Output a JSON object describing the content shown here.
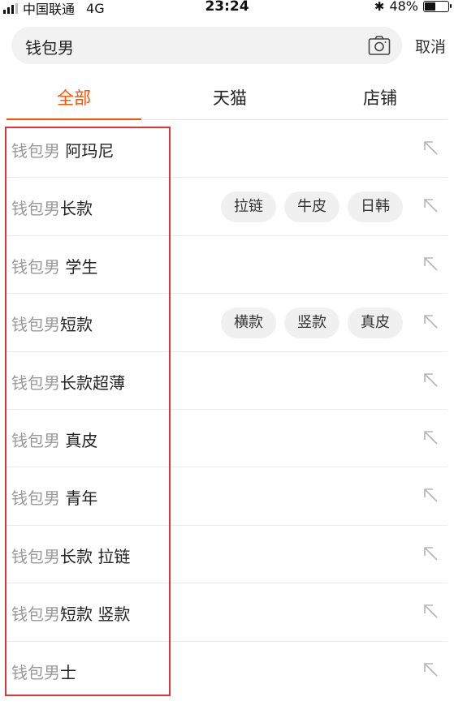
{
  "status_bar": {
    "carrier": "中国联通",
    "network": "4G",
    "time": "23:24",
    "bluetooth": "✱",
    "battery": "48%",
    "battery_level": 0.48
  },
  "search": {
    "query": "钱包男",
    "cancel_label": "取消"
  },
  "tabs": [
    {
      "label": "全部",
      "active": true
    },
    {
      "label": "天猫",
      "active": false
    },
    {
      "label": "店铺",
      "active": false
    }
  ],
  "suggestions": [
    {
      "prefix": "钱包男 ",
      "rest": "阿玛尼",
      "tags": []
    },
    {
      "prefix": "钱包男",
      "rest": "长款",
      "tags": [
        "拉链",
        "牛皮",
        "日韩"
      ]
    },
    {
      "prefix": "钱包男 ",
      "rest": "学生",
      "tags": []
    },
    {
      "prefix": "钱包男",
      "rest": "短款",
      "tags": [
        "横款",
        "竖款",
        "真皮"
      ]
    },
    {
      "prefix": "钱包男",
      "rest": "长款超薄",
      "tags": []
    },
    {
      "prefix": "钱包男 ",
      "rest": "真皮",
      "tags": []
    },
    {
      "prefix": "钱包男 ",
      "rest": "青年",
      "tags": []
    },
    {
      "prefix": "钱包男",
      "rest": "长款 拉链",
      "tags": []
    },
    {
      "prefix": "钱包男",
      "rest": "短款 竖款",
      "tags": []
    },
    {
      "prefix": "钱包男",
      "rest": "士",
      "tags": []
    }
  ],
  "colors": {
    "accent": "#ff5000",
    "highlight": "#e0343c"
  },
  "icons": {
    "camera": "camera-icon",
    "fill": "arrow-up-left-icon"
  }
}
